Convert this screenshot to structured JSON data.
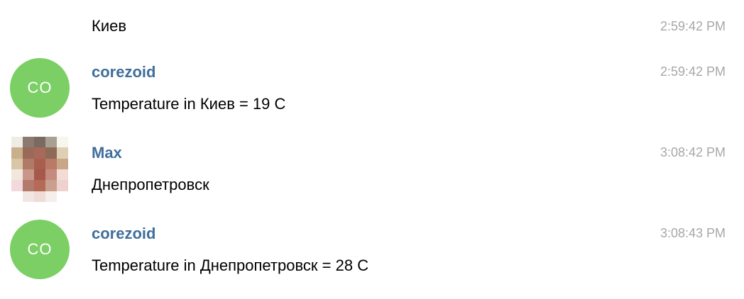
{
  "messages": [
    {
      "text": "Киев",
      "time": "2:59:42 PM"
    },
    {
      "avatar_initials": "CO",
      "sender": "corezoid",
      "text": "Temperature in Киев = 19 C",
      "time": "2:59:42 PM"
    },
    {
      "sender": "Max",
      "text": "Днепропетровск",
      "time": "3:08:42 PM"
    },
    {
      "avatar_initials": "CO",
      "sender": "corezoid",
      "text": "Temperature in Днепропетровск = 28 C",
      "time": "3:08:43 PM"
    }
  ],
  "colors": {
    "avatar_bg": "#7bcf65",
    "sender_name": "#3f6e9c",
    "timestamp": "#a7a7a7"
  }
}
